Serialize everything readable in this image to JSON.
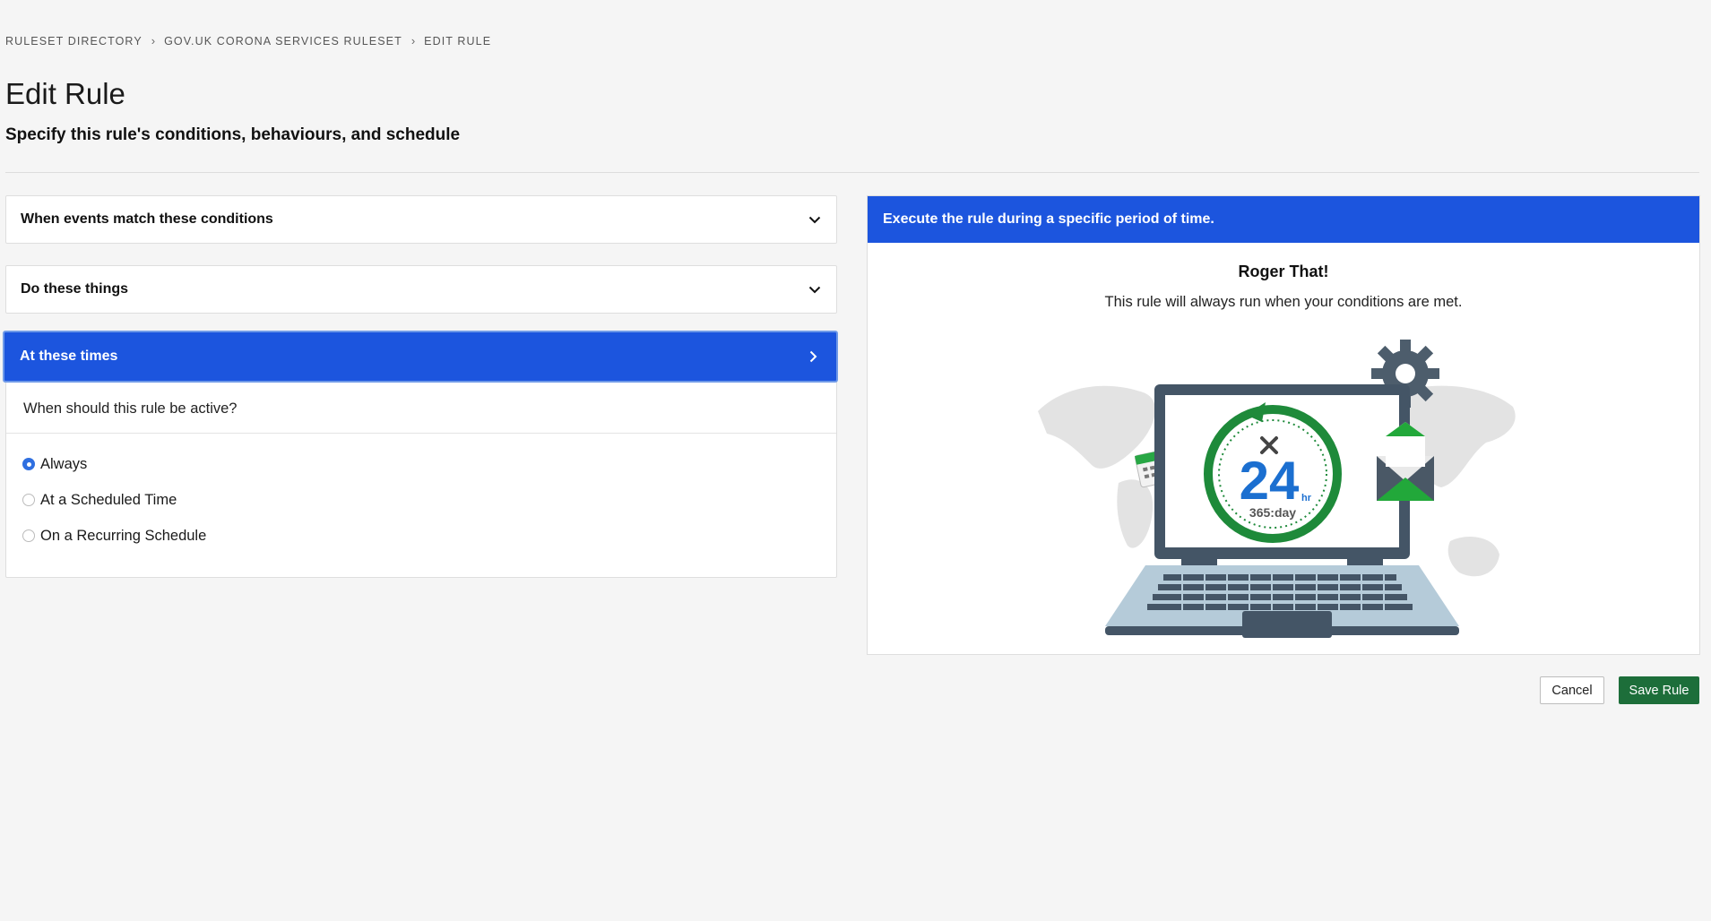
{
  "breadcrumb": {
    "items": [
      "RULESET DIRECTORY",
      "GOV.UK CORONA SERVICES RULESET",
      "EDIT RULE"
    ],
    "separator": "›"
  },
  "page": {
    "title": "Edit Rule",
    "subtitle": "Specify this rule's conditions, behaviours, and schedule"
  },
  "sections": {
    "conditions": {
      "label": "When events match these conditions",
      "icon": "chevron-down-icon"
    },
    "actions": {
      "label": "Do these things",
      "icon": "chevron-down-icon"
    },
    "schedule": {
      "label": "At these times",
      "icon": "chevron-right-icon",
      "question": "When should this rule be active?",
      "options": [
        {
          "label": "Always",
          "selected": true
        },
        {
          "label": "At a Scheduled Time",
          "selected": false
        },
        {
          "label": "On a Recurring Schedule",
          "selected": false
        }
      ]
    }
  },
  "info_card": {
    "header": "Execute the rule during a specific period of time.",
    "title": "Roger That!",
    "text": "This rule will always run when your conditions are met.",
    "illustration": {
      "clock_number": "24",
      "clock_unit": "hr",
      "clock_caption": "365:day"
    }
  },
  "buttons": {
    "cancel": "Cancel",
    "save": "Save Rule"
  },
  "colors": {
    "accent": "#1c55de",
    "save": "#1d6e3a",
    "background": "#f5f5f5"
  }
}
